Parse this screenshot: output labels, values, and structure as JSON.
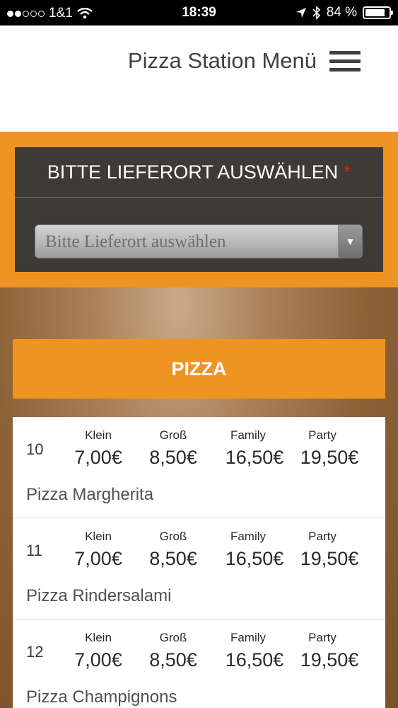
{
  "status_bar": {
    "carrier": "1&1",
    "time": "18:39",
    "battery_percent": "84 %",
    "battery_level": 0.84
  },
  "header": {
    "title": "Pizza Station Menü",
    "menu_icon": "hamburger-icon"
  },
  "delivery": {
    "title": "BITTE LIEFERORT AUSWÄHLEN",
    "required_mark": "*",
    "select_value": "Bitte Lieferort auswählen",
    "select_icon": "triangle-down-icon"
  },
  "section": {
    "title": "PIZZA"
  },
  "items": [
    {
      "number": "10",
      "name": "Pizza Margherita",
      "sizes": [
        {
          "label": "Klein",
          "price": "7,00€"
        },
        {
          "label": "Groß",
          "price": "8,50€"
        },
        {
          "label": "Family",
          "price": "16,50€"
        },
        {
          "label": "Party",
          "price": "19,50€"
        }
      ]
    },
    {
      "number": "11",
      "name": "Pizza Rindersalami",
      "sizes": [
        {
          "label": "Klein",
          "price": "7,00€"
        },
        {
          "label": "Groß",
          "price": "8,50€"
        },
        {
          "label": "Family",
          "price": "16,50€"
        },
        {
          "label": "Party",
          "price": "19,50€"
        }
      ]
    },
    {
      "number": "12",
      "name": "Pizza Champignons",
      "sizes": [
        {
          "label": "Klein",
          "price": "7,00€"
        },
        {
          "label": "Groß",
          "price": "8,50€"
        },
        {
          "label": "Family",
          "price": "16,50€"
        },
        {
          "label": "Party",
          "price": "19,50€"
        }
      ]
    }
  ],
  "colors": {
    "accent_orange": "#ef9322",
    "dark_panel": "#3d3a37",
    "required_red": "#e0201a"
  }
}
